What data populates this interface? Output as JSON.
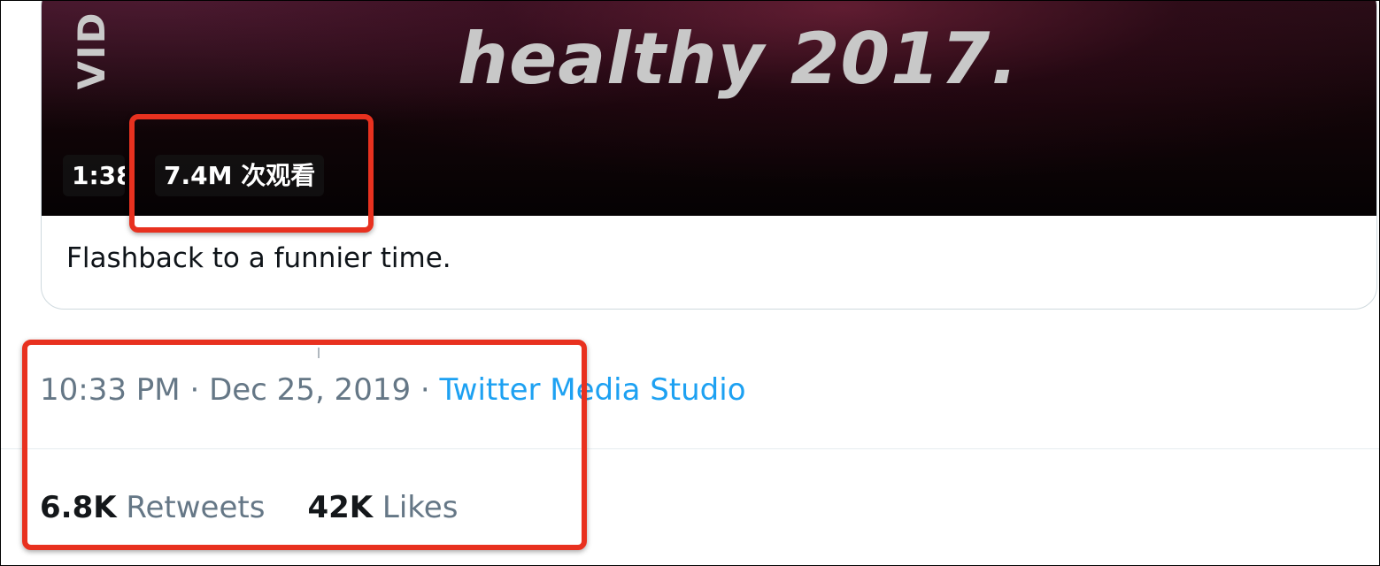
{
  "video": {
    "side_text": "VID",
    "headline": "healthy 2017.",
    "duration": "1:38",
    "views": "7.4M 次观看"
  },
  "tweet": {
    "caption": "Flashback to a funnier time.",
    "time": "10:33 PM",
    "date": "Dec 25, 2019",
    "separator": " · ",
    "source": "Twitter Media Studio"
  },
  "stats": {
    "retweets_count": "6.8K",
    "retweets_label": "Retweets",
    "likes_count": "42K",
    "likes_label": "Likes"
  },
  "colors": {
    "link": "#1da1f2",
    "muted": "#657786",
    "highlight": "#e8311f"
  }
}
